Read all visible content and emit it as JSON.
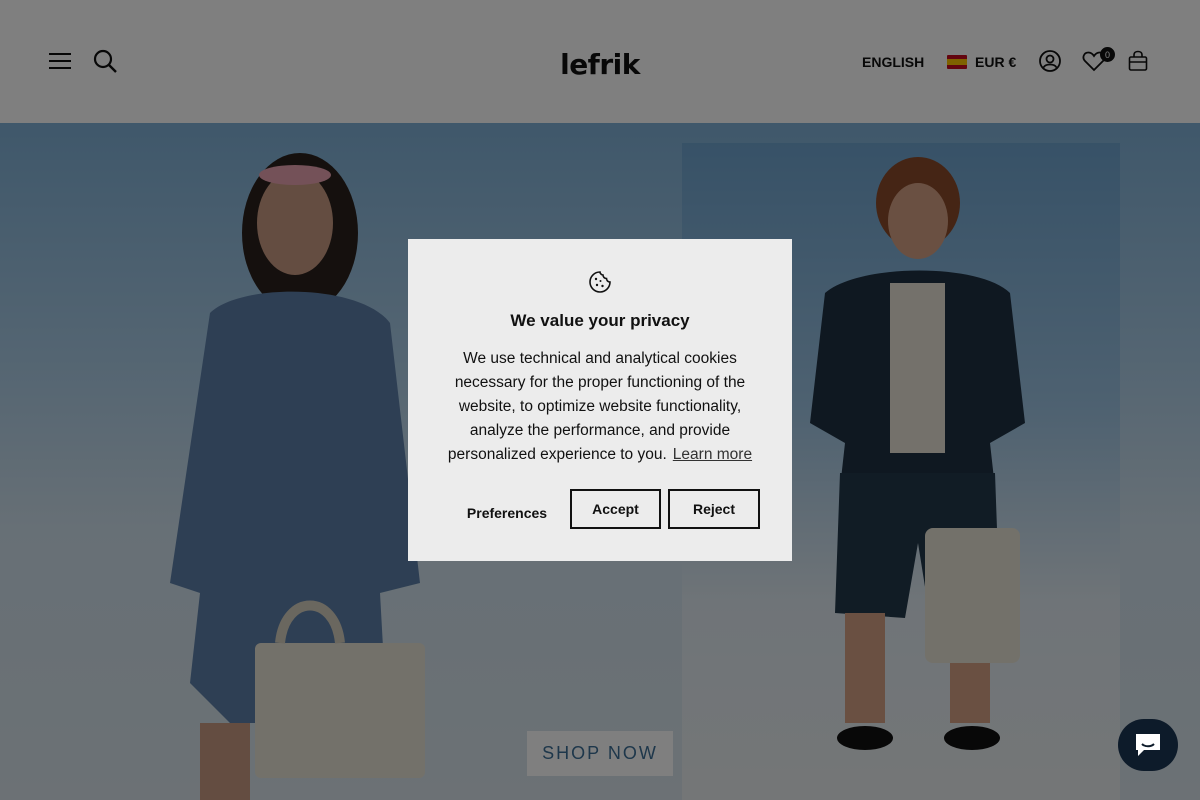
{
  "header": {
    "logo": "lefrik",
    "language": "ENGLISH",
    "currency": "EUR €",
    "wishlist_count": "0",
    "icons": [
      "menu-icon",
      "search-icon",
      "account-icon",
      "heart-icon",
      "cart-icon"
    ]
  },
  "hero": {
    "cta_label": "SHOP NOW"
  },
  "cookie_modal": {
    "icon": "cookie-icon",
    "title": "We value your privacy",
    "body": "We use technical and analytical cookies necessary for the proper functioning of the website, to optimize website functionality, analyze the performance, and provide personalized experience to you.",
    "learn_more": "Learn more",
    "preferences_label": "Preferences",
    "accept_label": "Accept",
    "reject_label": "Reject"
  },
  "chat": {
    "icon": "chat-icon"
  },
  "colors": {
    "accent_text": "#3c6f96",
    "overlay": "rgba(0,0,0,0.5)",
    "chat_bg": "#0d1b2a"
  }
}
